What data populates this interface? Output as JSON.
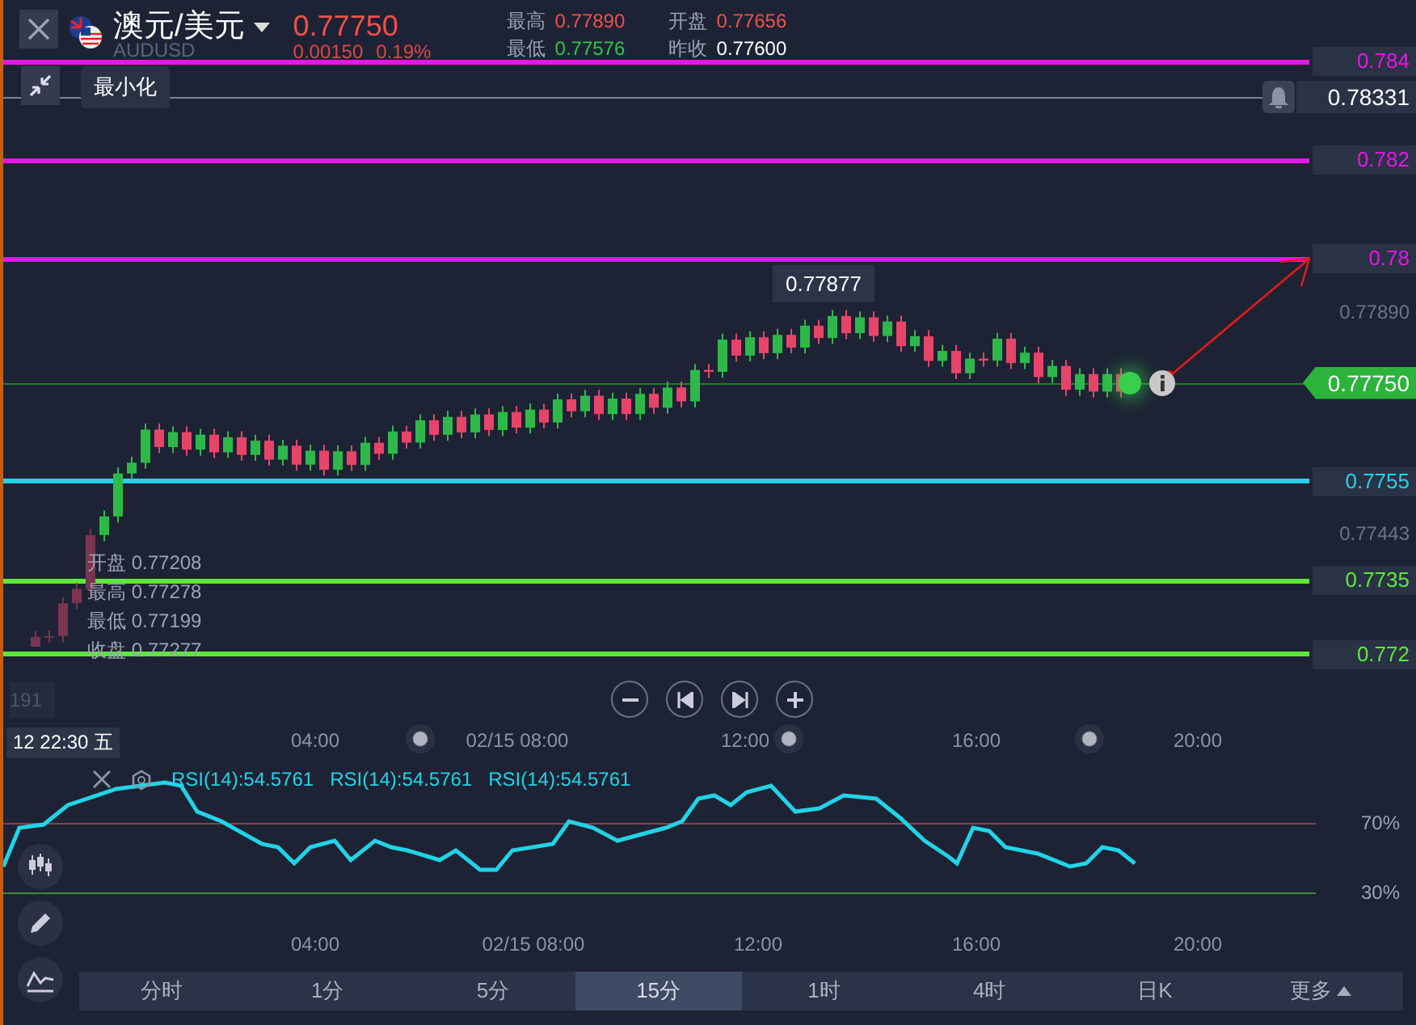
{
  "symbol": {
    "name": "澳元/美元",
    "code": "AUDUSD",
    "price": "0.77750",
    "change": "0.00150",
    "change_pct": "0.19%"
  },
  "stats": [
    {
      "label": "最高",
      "value": "0.77890",
      "kind": "up"
    },
    {
      "label": "开盘",
      "value": "0.77656",
      "kind": "up"
    },
    {
      "label": "最低",
      "value": "0.77576",
      "kind": "down"
    },
    {
      "label": "昨收",
      "value": "0.77600",
      "kind": "plain"
    }
  ],
  "minimize_tooltip": "最小化",
  "levels": [
    {
      "label": "0.784",
      "color": "#e815e8"
    },
    {
      "label": "0.782",
      "color": "#e815e8"
    },
    {
      "label": "0.78",
      "color": "#e815e8"
    },
    {
      "label": "0.7755",
      "color": "#22d3e6"
    },
    {
      "label": "0.7735",
      "color": "#5ee83a"
    },
    {
      "label": "0.772",
      "color": "#5ee83a"
    }
  ],
  "alert_price": "0.78331",
  "axis_prices": [
    "0.77890",
    "0.77443"
  ],
  "current_price": "0.77750",
  "hover_price": "0.77877",
  "ohlc": [
    {
      "label": "开盘",
      "value": "0.77208"
    },
    {
      "label": "最高",
      "value": "0.77278"
    },
    {
      "label": "最低",
      "value": "0.77199"
    },
    {
      "label": "收盘",
      "value": "0.77277"
    }
  ],
  "volume_label": "191",
  "cursor_time": "12 22:30 五",
  "time_labels": [
    "04:00",
    "02/15 08:00",
    "12:00",
    "16:00",
    "20:00"
  ],
  "rsi": {
    "labels": [
      "RSI(14):54.5761",
      "RSI(14):54.5761",
      "RSI(14):54.5761"
    ],
    "upper": "70%",
    "lower": "30%"
  },
  "rsi_time_labels": [
    "04:00",
    "02/15 08:00",
    "12:00",
    "16:00",
    "20:00"
  ],
  "periods": [
    {
      "label": "分时",
      "selected": false
    },
    {
      "label": "1分",
      "selected": false
    },
    {
      "label": "5分",
      "selected": false
    },
    {
      "label": "15分",
      "selected": true
    },
    {
      "label": "1时",
      "selected": false
    },
    {
      "label": "4时",
      "selected": false
    },
    {
      "label": "日K",
      "selected": false
    },
    {
      "label": "更多",
      "selected": false,
      "kind": "menu"
    }
  ]
}
